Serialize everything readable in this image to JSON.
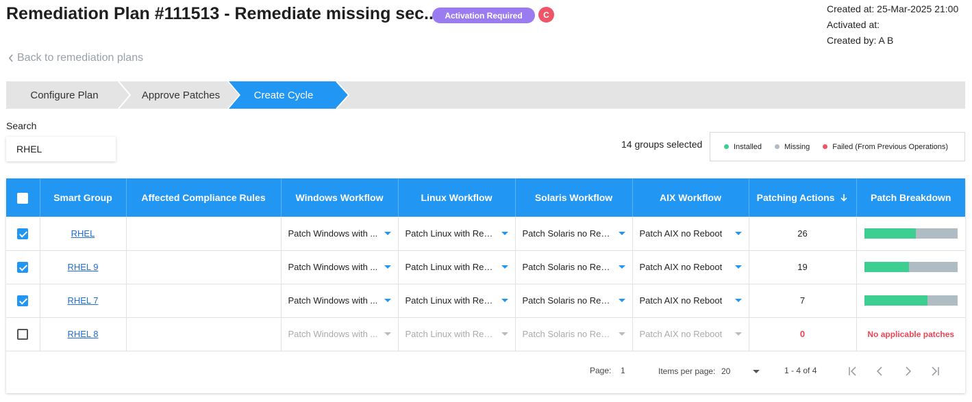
{
  "header": {
    "title": "Remediation Plan #111513 - Remediate missing sec...",
    "status_badge": "Activation Required",
    "avatar_initial": "C",
    "created_at": "Created at: 25-Mar-2025 21:00",
    "activated_at": "Activated at:",
    "created_by": "Created by: A B"
  },
  "back_link": "Back to remediation plans",
  "stepper": {
    "steps": [
      "Configure Plan",
      "Approve Patches",
      "Create Cycle"
    ],
    "active_index": 2
  },
  "search": {
    "label": "Search",
    "value": "RHEL"
  },
  "selection": {
    "count_text": "14 groups selected"
  },
  "legend": {
    "installed": "Installed",
    "missing": "Missing",
    "failed": "Failed (From Previous Operations)",
    "colors": {
      "installed": "#3ccf91",
      "missing": "#b0bcc3",
      "failed": "#ee5566"
    }
  },
  "table": {
    "columns": {
      "smart_group": "Smart Group",
      "affected_rules": "Affected Compliance Rules",
      "windows": "Windows Workflow",
      "linux": "Linux Workflow",
      "solaris": "Solaris Workflow",
      "aix": "AIX Workflow",
      "actions": "Patching Actions",
      "breakdown": "Patch Breakdown"
    },
    "sort_column": "Patching Actions",
    "sort_direction": "descending",
    "rows": [
      {
        "checked": true,
        "group": "RHEL",
        "rules": "",
        "windows": "Patch Windows with ...",
        "linux": "Patch Linux with Reb...",
        "solaris": "Patch Solaris no Reb...",
        "aix": "Patch AIX no Reboot",
        "actions": "26",
        "installed_fraction": 0.55,
        "breakdown_text": ""
      },
      {
        "checked": true,
        "group": "RHEL 9",
        "rules": "",
        "windows": "Patch Windows with ...",
        "linux": "Patch Linux with Reb...",
        "solaris": "Patch Solaris no Reb...",
        "aix": "Patch AIX no Reboot",
        "actions": "19",
        "installed_fraction": 0.48,
        "breakdown_text": ""
      },
      {
        "checked": true,
        "group": "RHEL 7",
        "rules": "",
        "windows": "Patch Windows with ...",
        "linux": "Patch Linux with Reb...",
        "solaris": "Patch Solaris no Reb...",
        "aix": "Patch AIX no Reboot",
        "actions": "7",
        "installed_fraction": 0.68,
        "breakdown_text": ""
      },
      {
        "checked": false,
        "group": "RHEL 8",
        "rules": "",
        "windows": "Patch Windows with ...",
        "linux": "Patch Linux with Reb...",
        "solaris": "Patch Solaris no Reb...",
        "aix": "Patch AIX no Reboot",
        "actions": "0",
        "installed_fraction": 0,
        "breakdown_text": "No applicable patches"
      }
    ]
  },
  "pagination": {
    "page_label": "Page:",
    "page_value": "1",
    "items_label": "Items per page:",
    "items_value": "20",
    "range": "1 - 4 of 4"
  }
}
